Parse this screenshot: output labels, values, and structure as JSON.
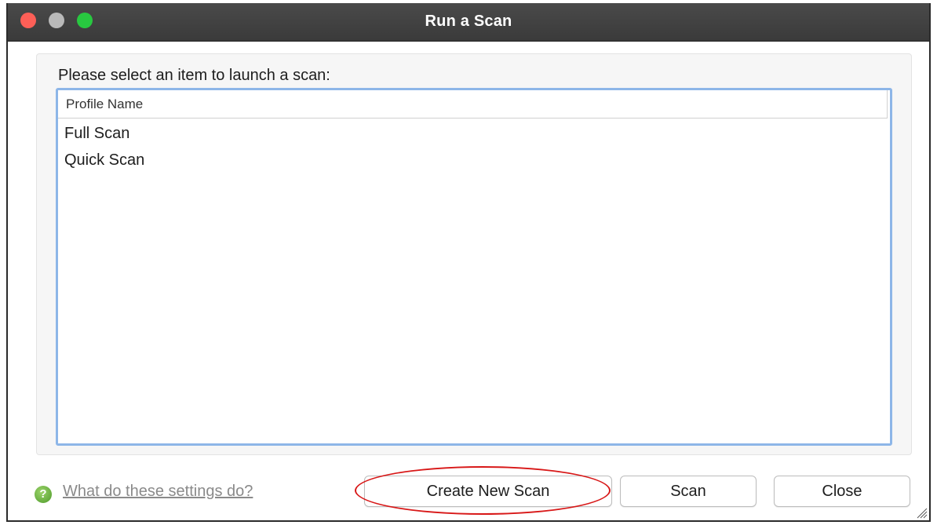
{
  "window": {
    "title": "Run a Scan"
  },
  "panel": {
    "prompt": "Please select an item to launch a scan:",
    "list": {
      "column_header": "Profile Name",
      "items": [
        "Full Scan",
        "Quick Scan"
      ]
    }
  },
  "footer": {
    "help_link": "What do these settings do?",
    "help_icon": "?",
    "buttons": {
      "create_new_scan": "Create New Scan",
      "scan": "Scan",
      "close": "Close"
    }
  },
  "colors": {
    "titlebar": "#3f3f3f",
    "list_focus_border": "#8db6e8",
    "highlight_oval": "#d81818",
    "help_icon": "#5aa832"
  },
  "icons": {
    "close_traffic": "red-circle",
    "minimize_traffic": "gray-circle",
    "zoom_traffic": "green-circle",
    "help": "help-icon",
    "resize": "resize-grip-icon"
  }
}
